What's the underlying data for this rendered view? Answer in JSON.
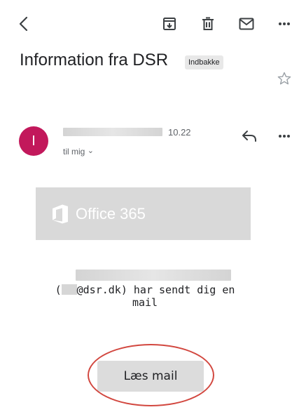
{
  "toolbar": {
    "back_icon": "chevron-left-icon",
    "archive_icon": "archive-icon",
    "delete_icon": "trash-icon",
    "mark_unread_icon": "mail-icon",
    "more_icon": "more-horizontal-icon"
  },
  "email": {
    "subject": "Information fra DSR",
    "label": "Indbakke",
    "star_icon": "star-outline-icon"
  },
  "sender": {
    "avatar_initial": "I",
    "avatar_color": "#c2185b",
    "time": "10.22",
    "recipient_text": "til mig",
    "recipient_chevron": "⌄",
    "reply_icon": "reply-icon",
    "more_icon": "more-horizontal-icon"
  },
  "body": {
    "banner_text": "Office 365",
    "message_paren_open": "(",
    "message_rest_line1": "@dsr.dk) har sendt dig en",
    "message_line2": "mail",
    "button_label": "Læs mail",
    "annotation_color": "#d2473f"
  }
}
